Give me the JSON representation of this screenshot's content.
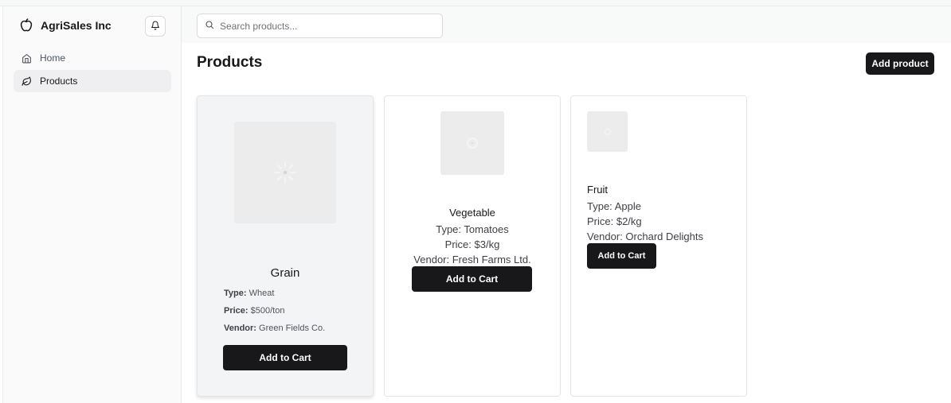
{
  "app": {
    "name": "AgriSales Inc",
    "logo_icon": "apple-icon",
    "bell_icon": "bell-icon"
  },
  "sidebar": {
    "items": [
      {
        "label": "Home",
        "icon": "home-icon",
        "active": false
      },
      {
        "label": "Products",
        "icon": "leaf-icon",
        "active": true
      }
    ]
  },
  "search": {
    "placeholder": "Search products...",
    "value": "",
    "icon": "search-icon"
  },
  "page": {
    "title": "Products",
    "add_label": "Add product"
  },
  "products": [
    {
      "name": "Grain",
      "type_key": "Type:",
      "type": "Wheat",
      "price_key": "Price:",
      "price": "$500/ton",
      "vendor_key": "Vendor:",
      "vendor": "Green Fields Co.",
      "cart_label": "Add to Cart"
    },
    {
      "name": "Vegetable",
      "type_line": "Type: Tomatoes",
      "price_line": "Price: $3/kg",
      "vendor_line": "Vendor: Fresh Farms Ltd.",
      "cart_label": "Add to Cart"
    },
    {
      "name": "Fruit",
      "type_line": "Type: Apple",
      "price_line": "Price: $2/kg",
      "vendor_line": "Vendor: Orchard Delights",
      "cart_label": "Add to Cart"
    }
  ],
  "colors": {
    "primary": "#18181b",
    "sidebar_bg": "#fafafa",
    "active_bg": "#efeff1",
    "placeholder_bg": "#ececec"
  }
}
